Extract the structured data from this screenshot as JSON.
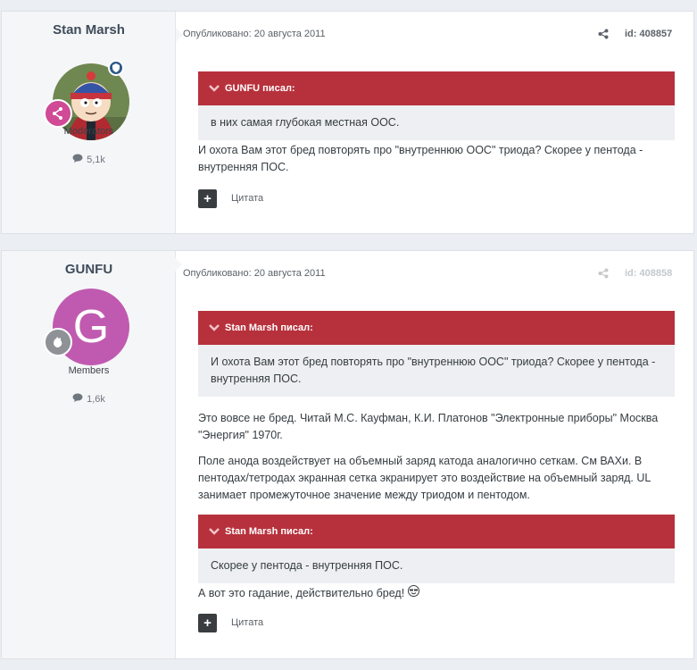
{
  "posts": [
    {
      "author": "Stan Marsh",
      "group": "Moderators",
      "count": "5,1k",
      "date": "Опубликовано: 20 августа 2011",
      "id": "id: 408857",
      "blocks": [
        {
          "type": "quote",
          "author": "GUNFU писал:",
          "text": "в них самая глубокая местная ООС."
        },
        {
          "type": "text",
          "text": "И охота Вам этот бред повторять про \"внутреннюю ООС\" триода? Скорее у пентода - внутренняя ПОС."
        }
      ],
      "cite": "Цитата"
    },
    {
      "author": "GUNFU",
      "avatar_letter": "G",
      "group": "Members",
      "count": "1,6k",
      "date": "Опубликовано: 20 августа 2011",
      "id": "id: 408858",
      "blocks": [
        {
          "type": "quote",
          "author": "Stan Marsh писал:",
          "text": "И охота Вам этот бред повторять про \"внутреннюю ООС\" триода? Скорее у пентода - внутренняя ПОС."
        },
        {
          "type": "text",
          "text": "Это вовсе не бред. Читай М.С. Кауфман, К.И. Платонов \"Электронные приборы\" Москва \"Энергия\" 1970г."
        },
        {
          "type": "text",
          "text": "Поле анода воздействует на объемный заряд катода аналогично сеткам. См ВАХи. В пентодах/тетродах экранная сетка экранирует это воздействие на объемный заряд. UL занимает промежуточное значение между триодом и пентодом."
        },
        {
          "type": "quote",
          "author": "Stan Marsh писал:",
          "text": "Скорее у пентода - внутренняя ПОС."
        },
        {
          "type": "text",
          "text": "А вот это гадание, действительно бред!"
        }
      ],
      "cite": "Цитата"
    }
  ],
  "colors": {
    "quote_header": "#b7313c",
    "moderator_badge": "#d04a96",
    "avatar_bg": "#c05ab0"
  },
  "icons": {
    "share": "share-icon",
    "comment": "comment-icon",
    "plus": "plus-icon",
    "chevron": "chevron-down-icon",
    "emoji": "emoji-icon"
  }
}
